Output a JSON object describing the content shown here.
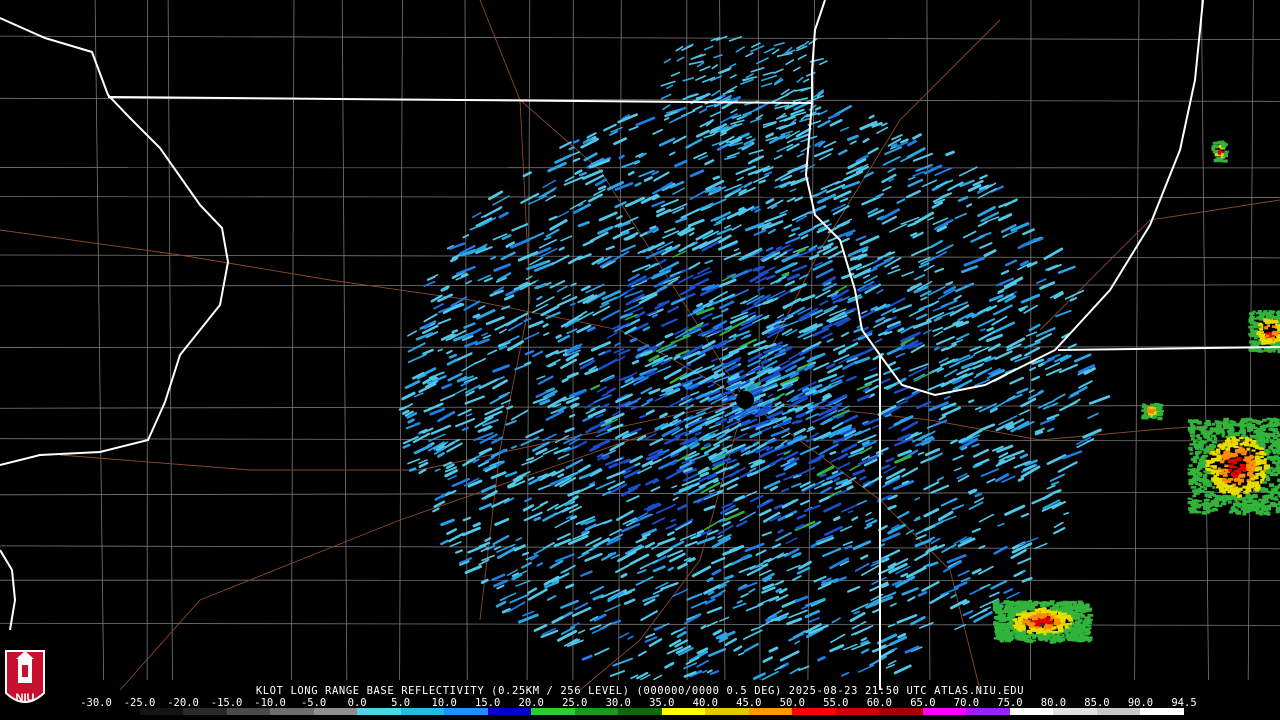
{
  "product": {
    "caption": "KLOT LONG RANGE BASE REFLECTIVITY (0.25KM / 256 LEVEL) (000000/0000 0.5 DEG) 2025-08-23 21:50 UTC  ATLAS.NIU.EDU"
  },
  "logo": {
    "text": "NIU",
    "color": "#c8102e"
  },
  "colorscale": {
    "labels": [
      "-30.0",
      "-25.0",
      "-20.0",
      "-15.0",
      "-10.0",
      "-5.0",
      "0.0",
      "5.0",
      "10.0",
      "15.0",
      "20.0",
      "25.0",
      "30.0",
      "35.0",
      "40.0",
      "45.0",
      "50.0",
      "55.0",
      "60.0",
      "65.0",
      "70.0",
      "75.0",
      "80.0",
      "85.0",
      "90.0",
      "94.5"
    ],
    "colors": [
      "#000000",
      "#141414",
      "#2a2a2a",
      "#4a4a4a",
      "#6e6e6e",
      "#8f8f8f",
      "#4fd4e8",
      "#29b8e8",
      "#1e90ff",
      "#0000c8",
      "#2ecc2e",
      "#1a9a1a",
      "#0b6b0b",
      "#ffff00",
      "#e6c800",
      "#ff9900",
      "#ff0000",
      "#cc0000",
      "#a00000",
      "#ff00ff",
      "#a020f0",
      "#ffffff",
      "#e0e0e0",
      "#c8c8c8",
      "#ffffff"
    ]
  },
  "map": {
    "state_border_color": "#ffffff",
    "county_line_color": "#7a7a7a",
    "road_color": "#8b4a2b",
    "water_color": "#000000",
    "echo_colors": [
      "#4fc8ea",
      "#2aa6e6",
      "#1e7fe8",
      "#1a4fd0",
      "#32b43c"
    ],
    "storm_colors": [
      "#32b43c",
      "#e6dc00",
      "#ff8c00",
      "#e00000"
    ]
  }
}
